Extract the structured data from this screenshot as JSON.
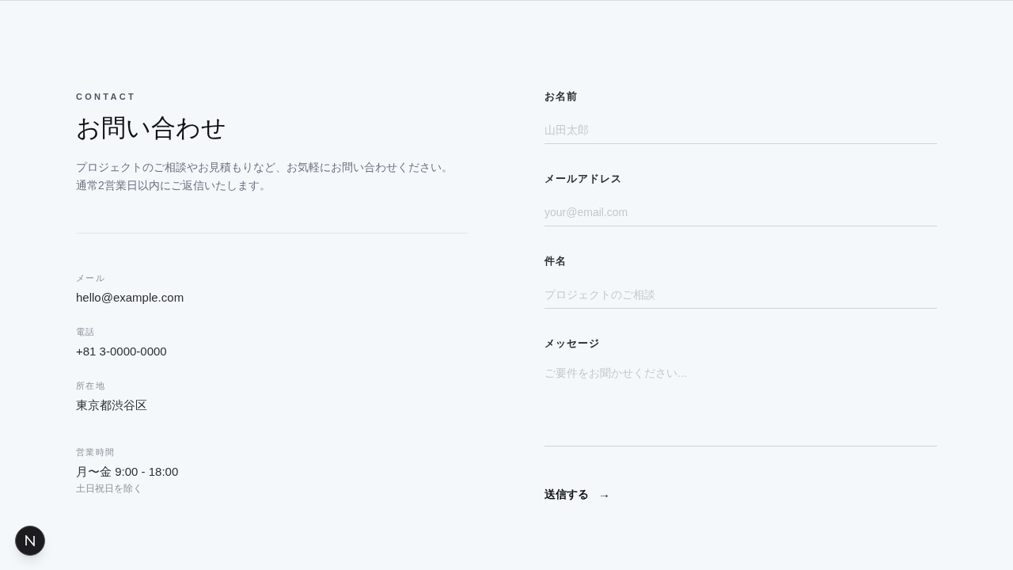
{
  "header": {
    "eyebrow": "CONTACT",
    "title": "お問い合わせ",
    "description": [
      "プロジェクトのご相談やお見積もりなど、お気軽にお問い合わせください。",
      "通常2営業日以内にご返信いたします。"
    ]
  },
  "info": [
    {
      "label": "メール",
      "value": "hello@example.com"
    },
    {
      "label": "電話",
      "value": "+81 3-0000-0000"
    },
    {
      "label": "所在地",
      "value": "東京都渋谷区"
    },
    {
      "label": "営業時間",
      "value": "月〜金 9:00 - 18:00",
      "note": "土日祝日を除く"
    }
  ],
  "form": {
    "fields": [
      {
        "kind": "input",
        "label": "お名前",
        "placeholder": "山田太郎"
      },
      {
        "kind": "input",
        "label": "メールアドレス",
        "placeholder": "your@email.com"
      },
      {
        "kind": "input",
        "label": "件名",
        "placeholder": "プロジェクトのご相談"
      },
      {
        "kind": "textarea",
        "label": "メッセージ",
        "placeholder": "ご要件をお聞かせください..."
      }
    ],
    "submit": {
      "label": "送信する",
      "arrow": "→"
    }
  }
}
